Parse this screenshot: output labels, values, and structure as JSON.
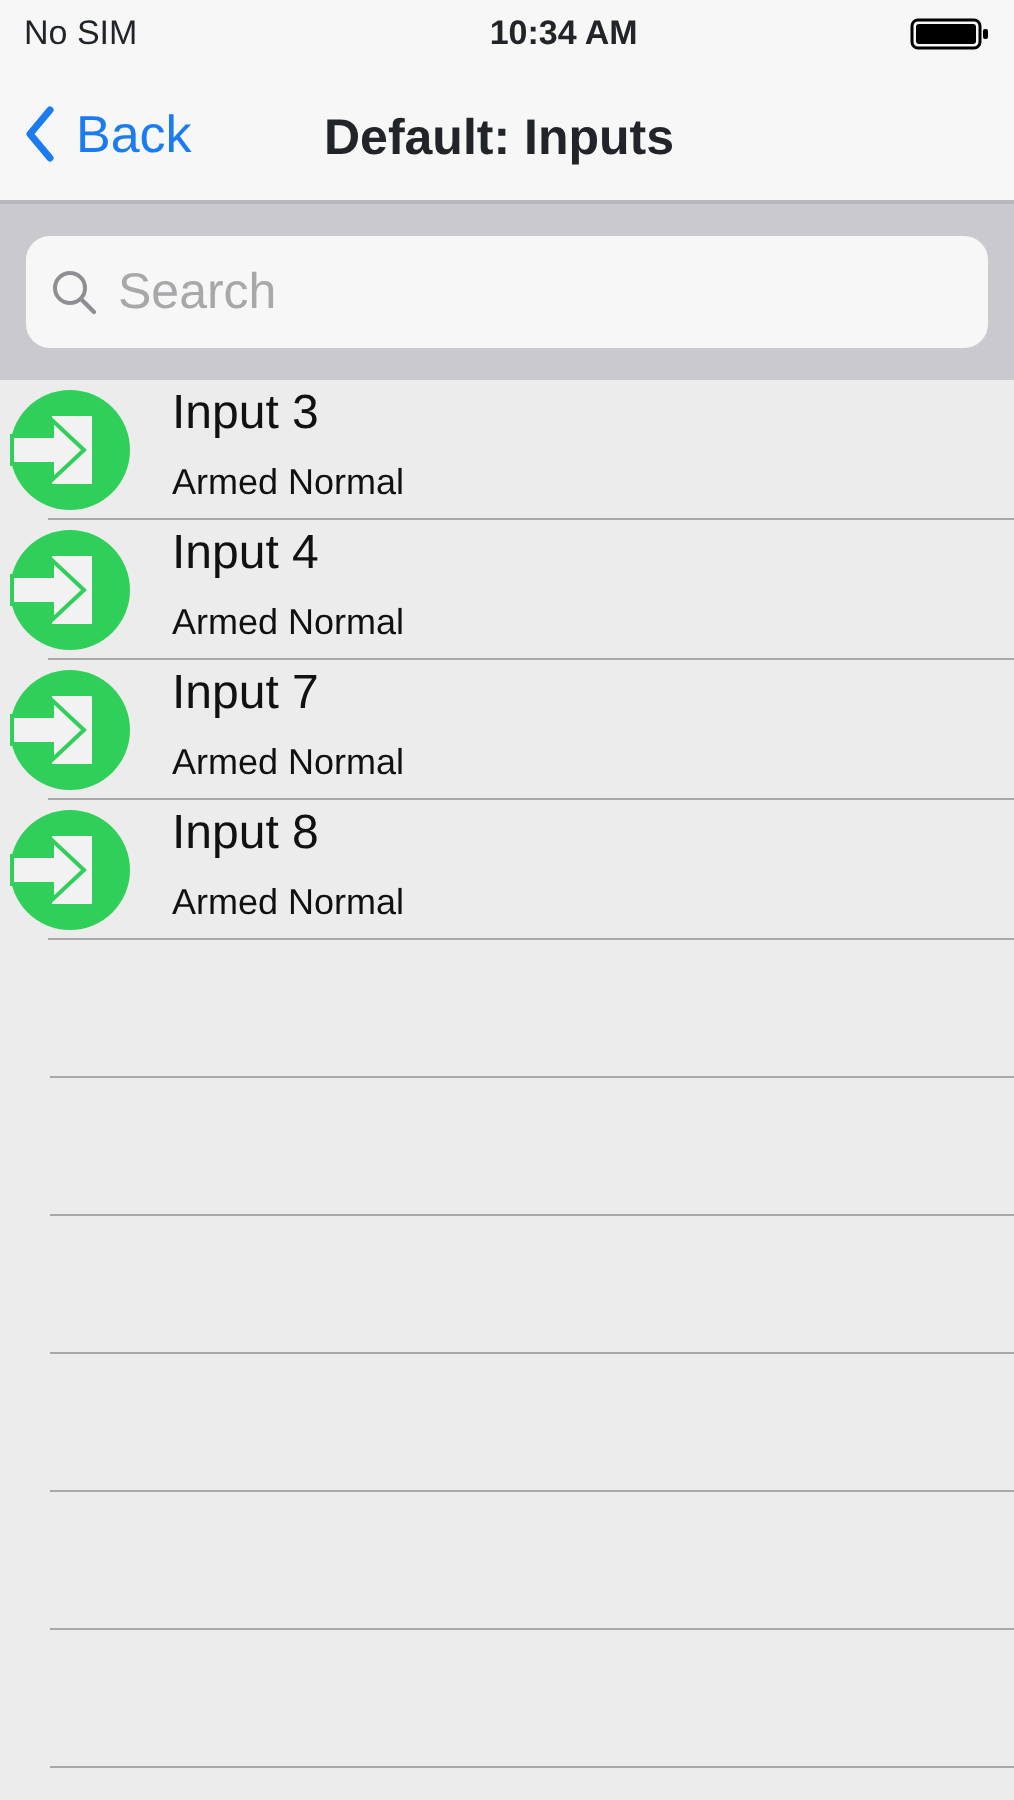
{
  "status_bar": {
    "carrier": "No SIM",
    "time": "10:34 AM"
  },
  "nav_bar": {
    "back": "Back",
    "title": "Default: Inputs"
  },
  "search": {
    "placeholder": "Search"
  },
  "inputs": [
    {
      "name": "Input 3",
      "status": "Armed Normal"
    },
    {
      "name": "Input 4",
      "status": "Armed Normal"
    },
    {
      "name": "Input 7",
      "status": "Armed Normal"
    },
    {
      "name": "Input 8",
      "status": "Armed Normal"
    }
  ]
}
